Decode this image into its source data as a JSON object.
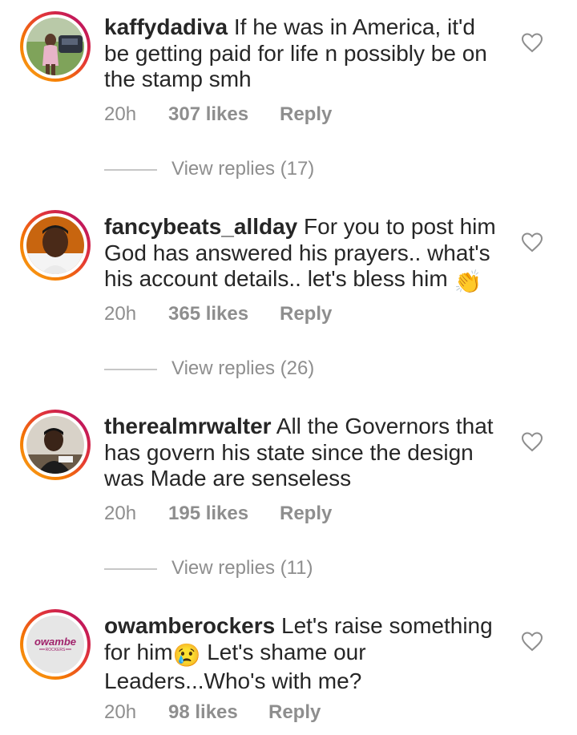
{
  "comments": [
    {
      "username": "kaffydadiva",
      "text": "If he was in America, it'd be getting paid for life n possibly be on the stamp smh",
      "time": "20h",
      "likes": "307 likes",
      "reply": "Reply",
      "view_replies": "View replies (17)"
    },
    {
      "username": "fancybeats_allday",
      "text": "For you to post him God has answered his prayers.. what's his account details.. let's bless him",
      "emoji": "👏",
      "time": "20h",
      "likes": "365 likes",
      "reply": "Reply",
      "view_replies": "View replies (26)"
    },
    {
      "username": "therealmrwalter",
      "text": "All the Governors that has govern his state since the design was Made are senseless",
      "time": "20h",
      "likes": "195 likes",
      "reply": "Reply",
      "view_replies": "View replies (11)"
    },
    {
      "username": "owamberockers",
      "text_before": "Let's raise something for him",
      "emoji": "😢",
      "text_after": "Let's shame our Leaders...Who's with me?",
      "time": "20h",
      "likes": "98 likes",
      "reply": "Reply",
      "avatar_logo": "owambe",
      "avatar_logo_sub": "ROCKERS"
    }
  ],
  "icons": {
    "like": "heart-outline-icon"
  },
  "colors": {
    "text": "#262626",
    "meta": "#8e8e8e",
    "ring_start": "#f9a825",
    "ring_end": "#8e24aa",
    "logo": "#a0226b"
  }
}
